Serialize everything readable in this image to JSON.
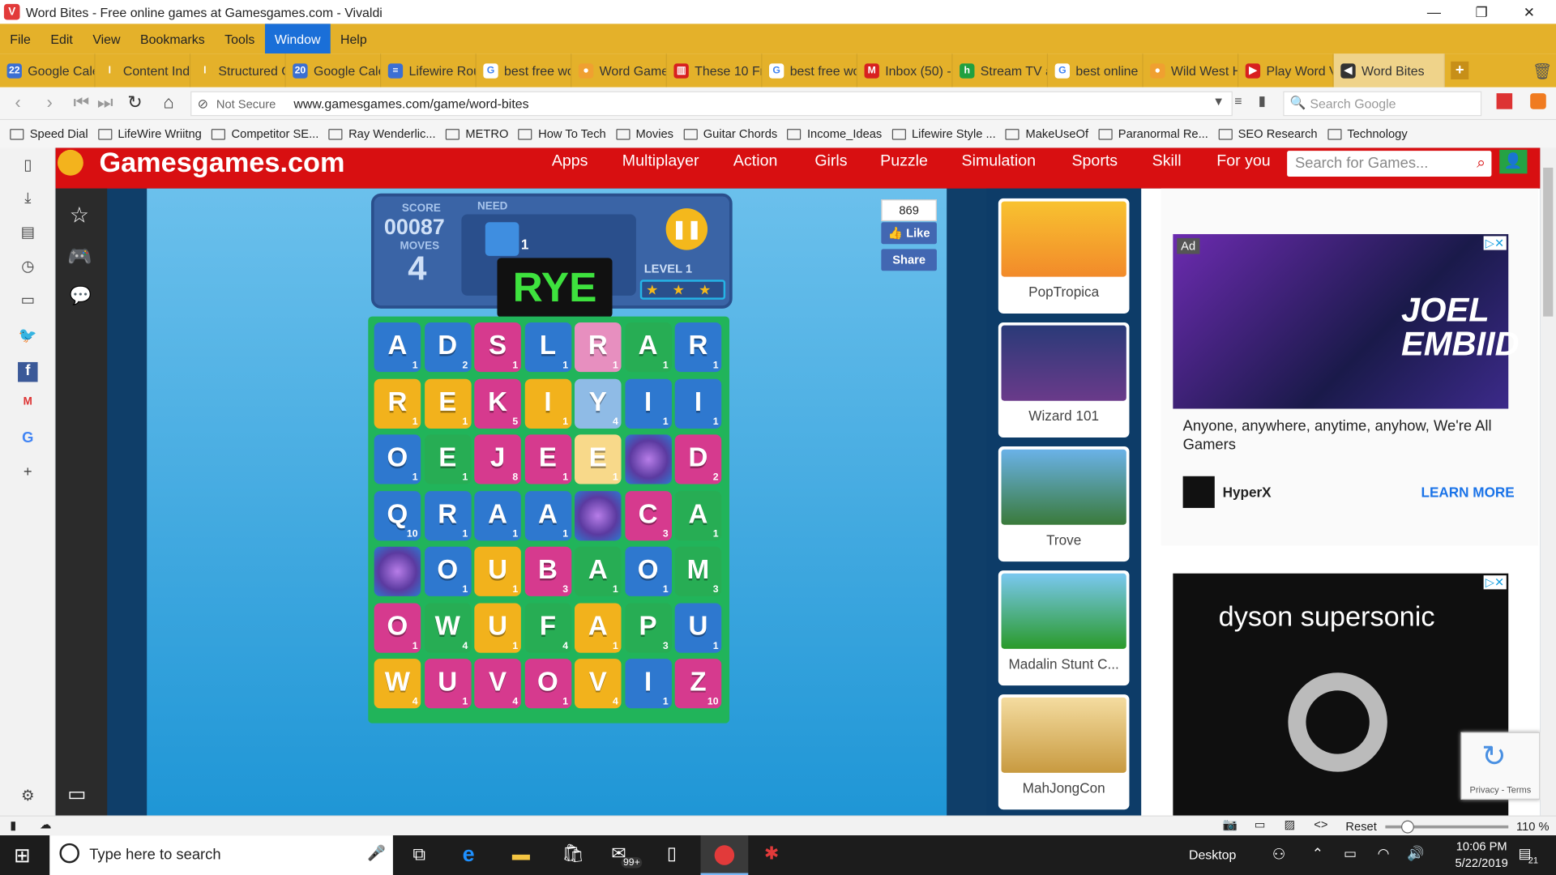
{
  "window": {
    "title": "Word Bites - Free online games at Gamesgames.com - Vivaldi"
  },
  "menu": [
    "File",
    "Edit",
    "View",
    "Bookmarks",
    "Tools",
    "Window",
    "Help"
  ],
  "tabs": [
    {
      "label": "Google Cale",
      "color": "#3b6fd3",
      "glyph": "22"
    },
    {
      "label": "Content Ind",
      "color": "#e4b12a",
      "glyph": "l"
    },
    {
      "label": "Structured C",
      "color": "#e4b12a",
      "glyph": "l"
    },
    {
      "label": "Google Cale",
      "color": "#3b6fd3",
      "glyph": "20"
    },
    {
      "label": "Lifewire Rou",
      "color": "#3b6fd3",
      "glyph": "≡"
    },
    {
      "label": "best free wo",
      "color": "#ffffff",
      "glyph": "G"
    },
    {
      "label": "Word Game",
      "color": "#f0a030",
      "glyph": "●"
    },
    {
      "label": "These 10 Fre",
      "color": "#d82020",
      "glyph": "▥"
    },
    {
      "label": "best free wo",
      "color": "#ffffff",
      "glyph": "G"
    },
    {
      "label": "Inbox (50) -",
      "color": "#d82020",
      "glyph": "M"
    },
    {
      "label": "Stream TV a",
      "color": "#20a040",
      "glyph": "h"
    },
    {
      "label": "best online",
      "color": "#ffffff",
      "glyph": "G"
    },
    {
      "label": "Wild West H",
      "color": "#f0a030",
      "glyph": "●"
    },
    {
      "label": "Play Word V",
      "color": "#d82020",
      "glyph": "▶"
    },
    {
      "label": "Word Bites",
      "color": "#333333",
      "glyph": "◀"
    }
  ],
  "address": {
    "security": "Not Secure",
    "url": "www.gamesgames.com/game/word-bites",
    "search_placeholder": "Search Google"
  },
  "bookmarks": [
    "Speed Dial",
    "LifeWire Wriitng",
    "Competitor SE...",
    "Ray Wenderlic...",
    "METRO",
    "How To Tech",
    "Movies",
    "Guitar Chords",
    "Income_Ideas",
    "Lifewire Style ...",
    "MakeUseOf",
    "Paranormal Re...",
    "SEO Research",
    "Technology"
  ],
  "site": {
    "logo": "Gamesgames.com",
    "nav": [
      "Apps",
      "Multiplayer",
      "Action",
      "Girls",
      "Puzzle",
      "Simulation",
      "Sports",
      "Skill",
      "For you"
    ],
    "search_placeholder": "Search for Games..."
  },
  "game": {
    "score_label": "SCORE",
    "score": "00087",
    "need_label": "NEED",
    "need_count": "1",
    "moves_label": "MOVES",
    "moves": "4",
    "level": "LEVEL 1",
    "word": "RYE",
    "board": [
      [
        [
          "A",
          "1",
          "b"
        ],
        [
          "D",
          "2",
          "b"
        ],
        [
          "S",
          "1",
          "p"
        ],
        [
          "L",
          "1",
          "b"
        ],
        [
          "R",
          "1",
          "pk"
        ],
        [
          "A",
          "1",
          "g"
        ],
        [
          "R",
          "1",
          "b"
        ]
      ],
      [
        [
          "R",
          "1",
          "y"
        ],
        [
          "E",
          "1",
          "y"
        ],
        [
          "K",
          "5",
          "p"
        ],
        [
          "I",
          "1",
          "y"
        ],
        [
          "Y",
          "4",
          "lb"
        ],
        [
          "I",
          "1",
          "b"
        ],
        [
          "I",
          "1",
          "b"
        ]
      ],
      [
        [
          "O",
          "1",
          "b"
        ],
        [
          "E",
          "1",
          "g"
        ],
        [
          "J",
          "8",
          "p"
        ],
        [
          "E",
          "1",
          "p"
        ],
        [
          "E",
          "1",
          "ly"
        ],
        [
          "",
          "",
          "orb"
        ],
        [
          "D",
          "2",
          "p"
        ]
      ],
      [
        [
          "Q",
          "10",
          "b"
        ],
        [
          "R",
          "1",
          "b"
        ],
        [
          "A",
          "1",
          "b"
        ],
        [
          "A",
          "1",
          "b"
        ],
        [
          "",
          "",
          "orb"
        ],
        [
          "C",
          "3",
          "p"
        ],
        [
          "A",
          "1",
          "g"
        ]
      ],
      [
        [
          "",
          "",
          "orb"
        ],
        [
          "O",
          "1",
          "b"
        ],
        [
          "U",
          "1",
          "y"
        ],
        [
          "B",
          "3",
          "p"
        ],
        [
          "A",
          "1",
          "g"
        ],
        [
          "O",
          "1",
          "b"
        ],
        [
          "M",
          "3",
          "g"
        ]
      ],
      [
        [
          "O",
          "1",
          "p"
        ],
        [
          "W",
          "4",
          "g"
        ],
        [
          "U",
          "1",
          "y"
        ],
        [
          "F",
          "4",
          "g"
        ],
        [
          "A",
          "1",
          "y"
        ],
        [
          "P",
          "3",
          "g"
        ],
        [
          "U",
          "1",
          "b"
        ]
      ],
      [
        [
          "W",
          "4",
          "y"
        ],
        [
          "U",
          "1",
          "p"
        ],
        [
          "V",
          "4",
          "p"
        ],
        [
          "O",
          "1",
          "p"
        ],
        [
          "V",
          "4",
          "y"
        ],
        [
          "I",
          "1",
          "b"
        ],
        [
          "Z",
          "10",
          "p"
        ]
      ]
    ]
  },
  "facebook": {
    "count": "869",
    "like": "Like",
    "share": "Share"
  },
  "thumbs": [
    "PopTropica",
    "Wizard 101",
    "Trove",
    "Madalin Stunt C...",
    "MahJongCon"
  ],
  "ad1": {
    "badge": "Ad",
    "text": "Anyone, anywhere, anytime, anyhow, We're All Gamers",
    "brand": "HyperX",
    "cta": "LEARN MORE",
    "art": "JOEL EMBIID"
  },
  "ad2": {
    "brand": "dyson supersonic"
  },
  "recaptcha": "Privacy - Terms",
  "status": {
    "reset": "Reset",
    "zoom": "110 %"
  },
  "taskbar": {
    "search": "Type here to search",
    "desktop": "Desktop",
    "time": "10:06 PM",
    "date": "5/22/2019",
    "notif": "21",
    "badge": "99+"
  },
  "colors": {
    "accent": "#e4b12a",
    "site_red": "#d80f11",
    "tile_blue": "#2e78cf",
    "tile_pink": "#d63a8e",
    "tile_yellow": "#f2b21c",
    "tile_green": "#27ad54"
  }
}
